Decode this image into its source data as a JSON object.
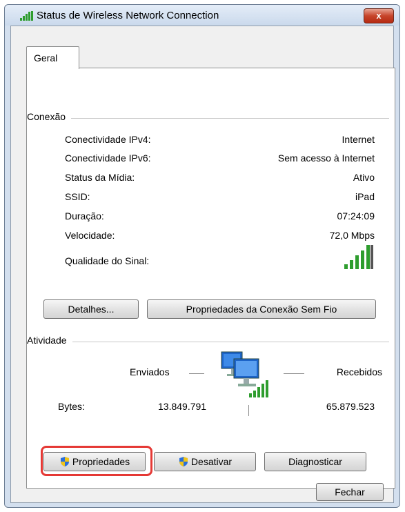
{
  "window": {
    "title": "Status de Wireless Network Connection",
    "close_label": "x"
  },
  "tabs": [
    {
      "label": "Geral",
      "selected": true
    }
  ],
  "connection": {
    "group_label": "Conexão",
    "rows": [
      {
        "label": "Conectividade IPv4:",
        "value": "Internet"
      },
      {
        "label": "Conectividade IPv6:",
        "value": "Sem acesso à Internet"
      },
      {
        "label": "Status da Mídia:",
        "value": "Ativo"
      },
      {
        "label": "SSID:",
        "value": "iPad"
      },
      {
        "label": "Duração:",
        "value": "07:24:09"
      },
      {
        "label": "Velocidade:",
        "value": "72,0 Mbps"
      }
    ],
    "signal_label": "Qualidade do Sinal:",
    "signal_bars": 5,
    "signal_level": 1.0,
    "details_button": "Detalhes...",
    "wireless_properties_button": "Propriedades da Conexão Sem Fio"
  },
  "activity": {
    "group_label": "Atividade",
    "sent_label": "Enviados",
    "received_label": "Recebidos",
    "bytes_label": "Bytes:",
    "bytes_sent": "13.849.791",
    "bytes_received": "65.879.523"
  },
  "actions": {
    "properties_button": "Propriedades",
    "disable_button": "Desativar",
    "diagnose_button": "Diagnosticar"
  },
  "footer": {
    "close_button": "Fechar"
  },
  "colors": {
    "highlight": "#e53935",
    "signal_green": "#2e9d2e",
    "titlebar": "#cad9ec"
  }
}
